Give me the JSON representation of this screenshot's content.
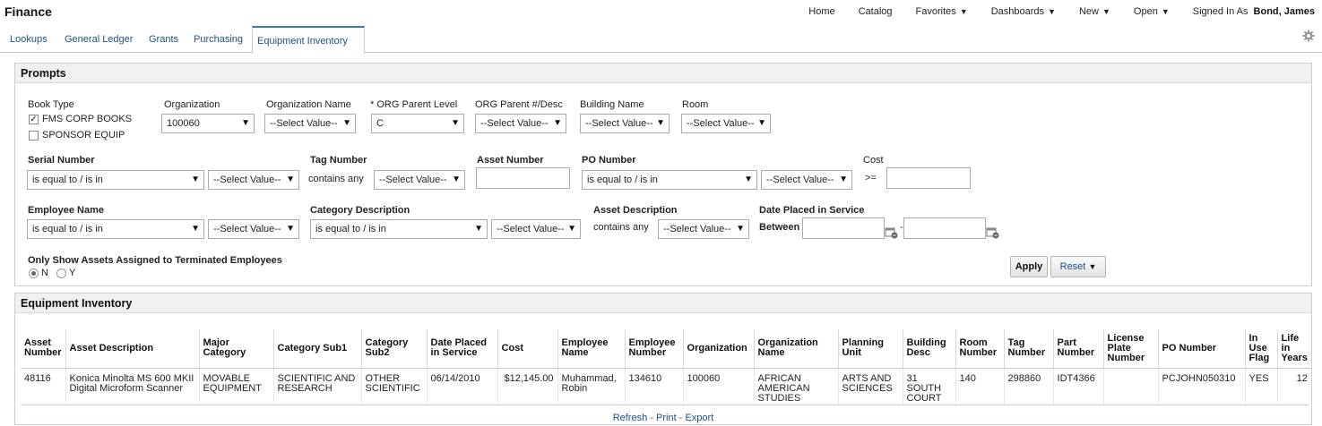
{
  "header": {
    "app_title": "Finance",
    "nav": [
      {
        "label": "Home",
        "caret": ""
      },
      {
        "label": "Catalog",
        "caret": ""
      },
      {
        "label": "Favorites",
        "caret": "▼"
      },
      {
        "label": "Dashboards",
        "caret": "▼"
      },
      {
        "label": "New",
        "caret": "▼"
      },
      {
        "label": "Open",
        "caret": "▼"
      }
    ],
    "signed_in_label": "Signed In As",
    "user_name": "Bond, James"
  },
  "tabs": [
    {
      "label": "Lookups",
      "active": false
    },
    {
      "label": "General Ledger",
      "active": false
    },
    {
      "label": "Grants",
      "active": false
    },
    {
      "label": "Purchasing",
      "active": false
    },
    {
      "label": "Equipment Inventory",
      "active": true
    }
  ],
  "prompts": {
    "title": "Prompts",
    "book_type": {
      "label": "Book Type",
      "options": [
        {
          "label": "FMS CORP BOOKS",
          "checked": true
        },
        {
          "label": "SPONSOR EQUIP",
          "checked": false
        }
      ]
    },
    "organization": {
      "label": "Organization",
      "value": "100060"
    },
    "organization_name": {
      "label": "Organization Name",
      "value": "--Select Value--"
    },
    "org_parent_level": {
      "label": "* ORG Parent Level",
      "value": "C"
    },
    "org_parent_desc": {
      "label": "ORG Parent #/Desc",
      "value": "--Select Value--"
    },
    "building_name": {
      "label": "Building Name",
      "value": "--Select Value--"
    },
    "room": {
      "label": "Room",
      "value": "--Select Value--"
    },
    "serial_number": {
      "label": "Serial Number",
      "operator": "is equal to / is in",
      "value": "--Select Value--"
    },
    "tag_number": {
      "label": "Tag Number",
      "operator": "contains any",
      "value": "--Select Value--"
    },
    "asset_number": {
      "label": "Asset Number",
      "value": ""
    },
    "po_number": {
      "label": "PO Number",
      "operator": "is equal to / is in",
      "value": "--Select Value--"
    },
    "cost": {
      "label": "Cost",
      "operator": ">=",
      "value": ""
    },
    "employee_name": {
      "label": "Employee Name",
      "operator": "is equal to / is in",
      "value": "--Select Value--"
    },
    "category_description": {
      "label": "Category Description",
      "operator": "is equal to / is in",
      "value": "--Select Value--"
    },
    "asset_description": {
      "label": "Asset Description",
      "operator": "contains any",
      "value": "--Select Value--"
    },
    "date_placed": {
      "label": "Date Placed in Service",
      "operator": "Between",
      "from": "",
      "to": "",
      "separator": "-"
    },
    "terminated": {
      "label": "Only Show Assets Assigned to Terminated Employees",
      "options": [
        {
          "label": "N",
          "selected": true
        },
        {
          "label": "Y",
          "selected": false
        }
      ]
    },
    "apply_label": "Apply",
    "reset_label": "Reset",
    "reset_caret": "▼"
  },
  "inventory": {
    "title": "Equipment Inventory",
    "columns": [
      "Asset Number",
      "Asset Description",
      "Major Category",
      "Category Sub1",
      "Category Sub2",
      "Date Placed in Service",
      "Cost",
      "Employee Name",
      "Employee Number",
      "Organization",
      "Organization Name",
      "Planning Unit",
      "Building Desc",
      "Room Number",
      "Tag Number",
      "Part Number",
      "License Plate Number",
      "PO Number",
      "In Use Flag",
      "Life in Years"
    ],
    "rows": [
      [
        "48116",
        "Konica Minolta MS 600 MKII Digital Microform Scanner",
        "MOVABLE EQUIPMENT",
        "SCIENTIFIC AND RESEARCH",
        "OTHER SCIENTIFIC",
        "06/14/2010",
        "$12,145.00",
        "Muhammad, Robin",
        "134610",
        "100060",
        "AFRICAN AMERICAN STUDIES",
        "ARTS AND SCIENCES",
        "31 SOUTH COURT",
        "140",
        "298860",
        "IDT4366",
        "",
        "PCJOHN050310",
        "YES",
        "12"
      ]
    ],
    "footer_links": [
      "Refresh",
      "Print",
      "Export"
    ],
    "footer_sep": " - "
  },
  "icons": {
    "gear": "gear-icon",
    "calendar": "calendar-icon",
    "dropdown": "chevron-down-icon"
  },
  "colors": {
    "link": "#1f4f82",
    "active_tab_accent": "#3d7bb8",
    "panel_header": "#eef0f2"
  }
}
